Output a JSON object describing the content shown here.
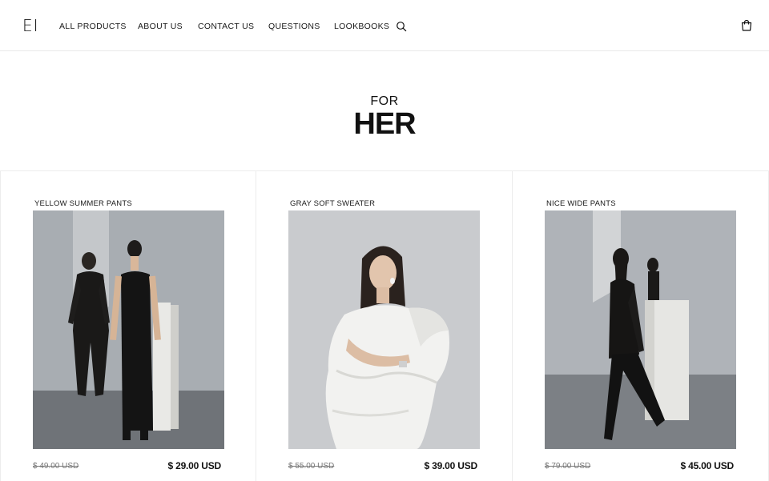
{
  "brand": {
    "logo": "EI"
  },
  "nav": {
    "items": [
      {
        "label": "ALL PRODUCTS"
      },
      {
        "label": "ABOUT US"
      },
      {
        "label": "CONTACT US"
      },
      {
        "label": "QUESTIONS"
      },
      {
        "label": "LOOKBOOKS"
      }
    ],
    "search_icon": "search-icon",
    "cart_icon": "shopping-bag-icon"
  },
  "hero": {
    "subtitle": "FOR",
    "title": "HER"
  },
  "products": [
    {
      "name": "YELLOW SUMMER PANTS",
      "old_price": "$ 49.00 USD",
      "price": "$ 29.00 USD",
      "image": "two women in black outfits standing beside white pedestal"
    },
    {
      "name": "GRAY SOFT SWEATER",
      "old_price": "$ 55.00 USD",
      "price": "$ 39.00 USD",
      "image": "woman in white ruffled strapless top"
    },
    {
      "name": "NICE WIDE PANTS",
      "old_price": "$ 79.00 USD",
      "price": "$ 45.00 USD",
      "image": "woman in black leather suit walking"
    }
  ],
  "colors": {
    "accent": "#111111",
    "muted": "#777777",
    "border": "#ececec"
  }
}
